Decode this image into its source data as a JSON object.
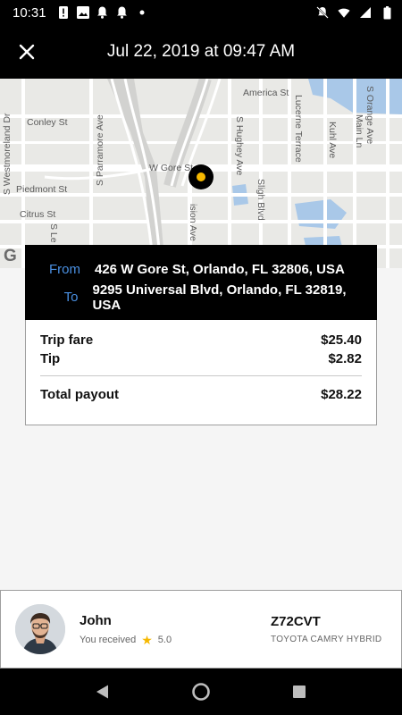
{
  "status_bar": {
    "time": "10:31",
    "left_icons": [
      "alert-icon",
      "image-icon",
      "notification-bell-icon",
      "notification-bell-icon",
      "dot-icon"
    ],
    "right_icons": [
      "mute-icon",
      "wifi-icon",
      "cell-signal-icon",
      "battery-icon"
    ]
  },
  "app_bar": {
    "title": "Jul 22, 2019 at 09:47 AM",
    "close_icon": "close-icon"
  },
  "map": {
    "streets": {
      "america": "America St",
      "orange": "S Orange Ave",
      "conley": "Conley St",
      "parramore": "S Parramore Ave",
      "westmoreland": "S Westmoreland Dr",
      "lucerne": "Lucerne Terrace",
      "kuhl": "Kuhl Ave",
      "main": "Main Ln",
      "hughey": "S Hughey Ave",
      "gore": "W Gore St",
      "piedmont": "Piedmont St",
      "citrus": "Citrus St",
      "sligh": "Sligh Blvd",
      "division": "ision Ave",
      "sle": "S Le"
    },
    "brand_mark": "G",
    "pin_color": "#f6b800"
  },
  "trip": {
    "from_label": "From",
    "from_address": "426 W Gore St, Orlando, FL 32806, USA",
    "to_label": "To",
    "to_address": "9295 Universal Blvd, Orlando, FL 32819, USA",
    "fare_label": "Trip fare",
    "fare_amount": "$25.40",
    "tip_label": "Tip",
    "tip_amount": "$2.82",
    "total_label": "Total payout",
    "total_amount": "$28.22"
  },
  "driver": {
    "name": "John",
    "rating_text": "You received",
    "rating_value": "5.0",
    "plate": "Z72CVT",
    "car_model": "TOYOTA  CAMRY HYBRID"
  },
  "nav_bar": {
    "buttons": [
      "back-icon",
      "home-icon",
      "recents-icon"
    ]
  },
  "colors": {
    "accent_blue": "#4a90e2",
    "accent_yellow": "#f6b800",
    "bar_black": "#000000"
  }
}
